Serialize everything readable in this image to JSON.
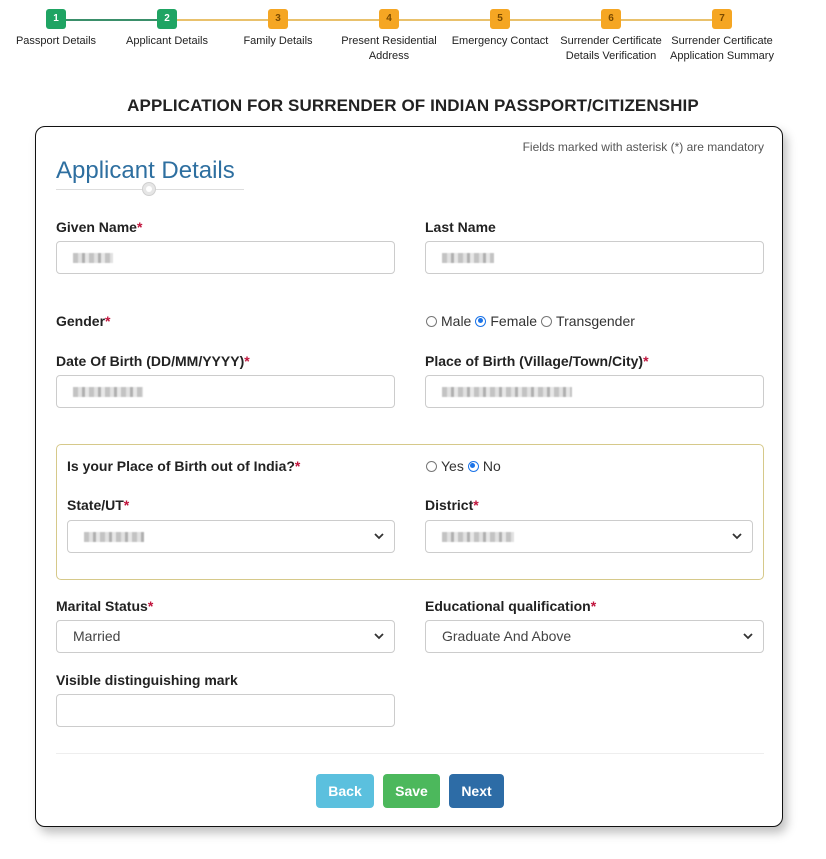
{
  "stepper": {
    "steps": [
      {
        "number": "1",
        "label": "Passport Details",
        "label2": "",
        "status": "done"
      },
      {
        "number": "2",
        "label": "Applicant Details",
        "label2": "",
        "status": "done"
      },
      {
        "number": "3",
        "label": "Family Details",
        "label2": "",
        "status": "todo"
      },
      {
        "number": "4",
        "label": "Present Residential",
        "label2": "Address",
        "status": "todo"
      },
      {
        "number": "5",
        "label": "Emergency Contact",
        "label2": "",
        "status": "todo"
      },
      {
        "number": "6",
        "label": "Surrender Certificate",
        "label2": "Details Verification",
        "status": "todo"
      },
      {
        "number": "7",
        "label": "Surrender Certificate",
        "label2": "Application Summary",
        "status": "todo"
      }
    ],
    "colors": {
      "done": "#1fa463",
      "todo": "#f5a623"
    }
  },
  "page_title": "APPLICATION FOR SURRENDER OF INDIAN PASSPORT/CITIZENSHIP",
  "form": {
    "mandatory_note": "Fields marked with asterisk (*) are mandatory",
    "section_title": "Applicant Details",
    "required_marker": "*",
    "given_name": {
      "label": "Given Name",
      "value": "[redacted]"
    },
    "last_name": {
      "label": "Last Name",
      "value": "[redacted]"
    },
    "gender": {
      "label": "Gender",
      "options": [
        "Male",
        "Female",
        "Transgender"
      ],
      "selected": "Female"
    },
    "dob": {
      "label": "Date Of Birth (DD/MM/YYYY)",
      "value": "[redacted]"
    },
    "place_of_birth": {
      "label": "Place of Birth (Village/Town/City)",
      "value": "[redacted]"
    },
    "birth_outside_india": {
      "label": "Is your Place of Birth out of India?",
      "options": [
        "Yes",
        "No"
      ],
      "selected": "No"
    },
    "state": {
      "label": "State/UT",
      "value": "[redacted]"
    },
    "district": {
      "label": "District",
      "value": "[redacted]"
    },
    "marital_status": {
      "label": "Marital Status",
      "value": "Married"
    },
    "education": {
      "label": "Educational qualification",
      "value": "Graduate And Above"
    },
    "distinguishing_mark": {
      "label": "Visible distinguishing mark",
      "value": ""
    }
  },
  "buttons": {
    "back": "Back",
    "save": "Save",
    "next": "Next"
  }
}
